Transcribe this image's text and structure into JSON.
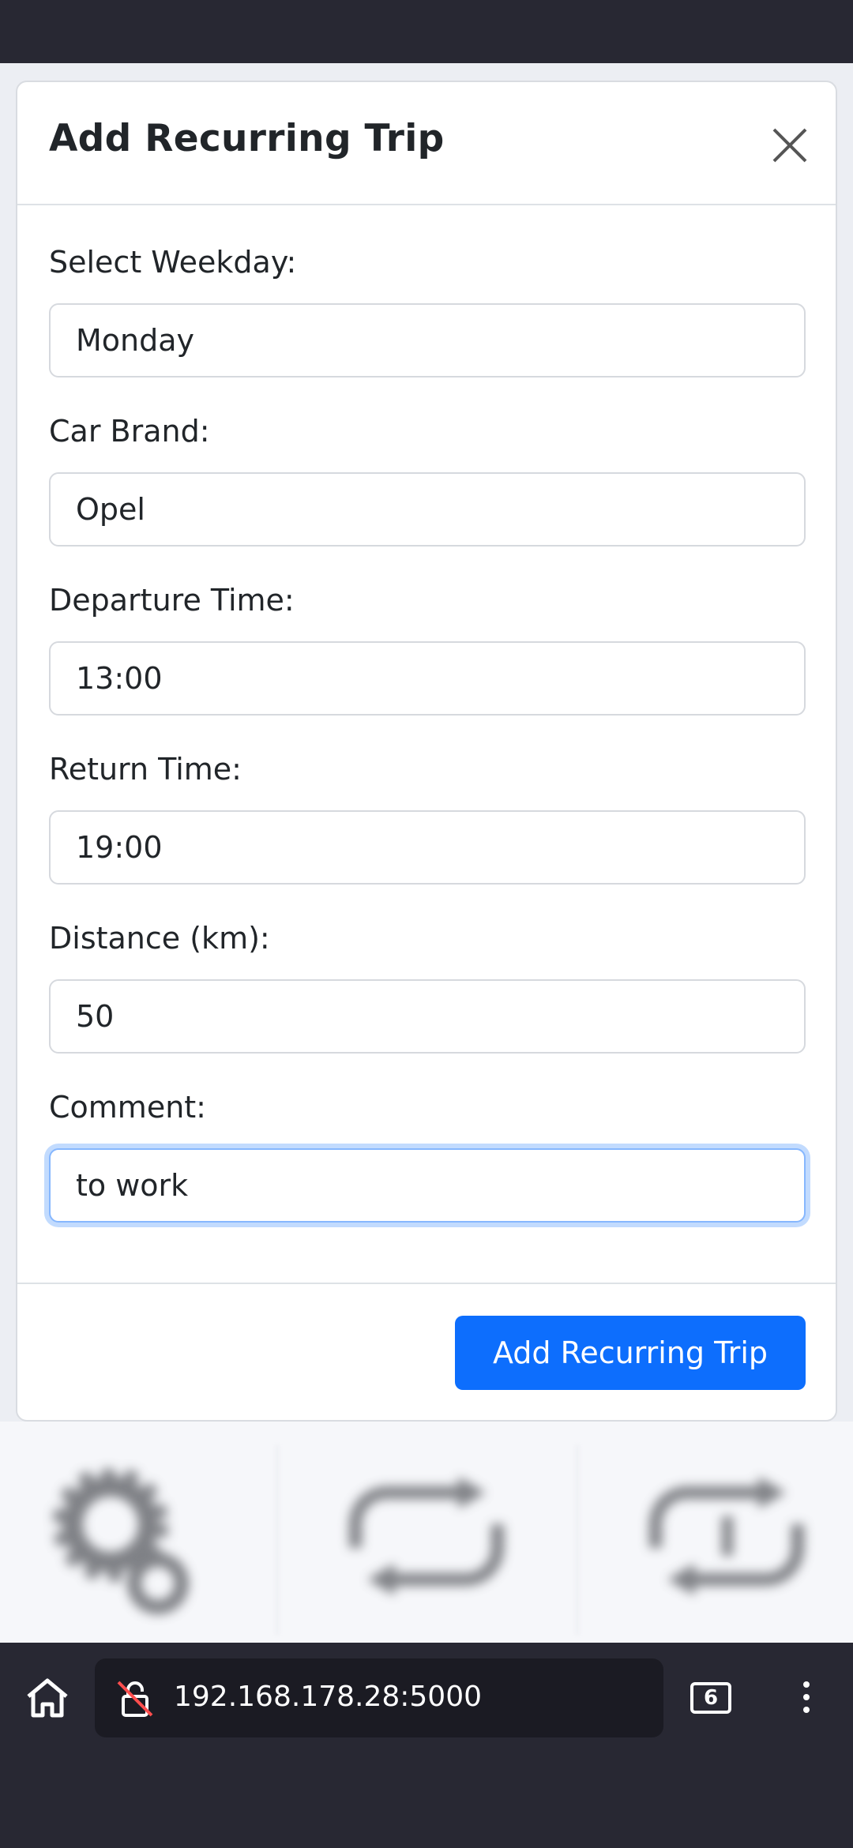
{
  "modal": {
    "title": "Add Recurring Trip",
    "close_icon": "close-icon",
    "fields": [
      {
        "label": "Select Weekday:",
        "value": "Monday"
      },
      {
        "label": "Car Brand:",
        "value": "Opel"
      },
      {
        "label": "Departure Time:",
        "value": "13:00"
      },
      {
        "label": "Return Time:",
        "value": "19:00"
      },
      {
        "label": "Distance (km):",
        "value": "50"
      },
      {
        "label": "Comment:",
        "value": "to work"
      }
    ],
    "submit_label": "Add Recurring Trip"
  },
  "background_icons": [
    "gears-icon",
    "repeat-icon",
    "repeat-once-icon"
  ],
  "browser": {
    "url": "192.168.178.28:5000",
    "tab_count": "6",
    "icons": [
      "home-icon",
      "insecure-lock-icon",
      "tabs-icon",
      "more-vert-icon"
    ]
  },
  "colors": {
    "primary": "#0d6efd",
    "focus_ring": "#86b7fe",
    "browser_chrome": "#282833"
  }
}
